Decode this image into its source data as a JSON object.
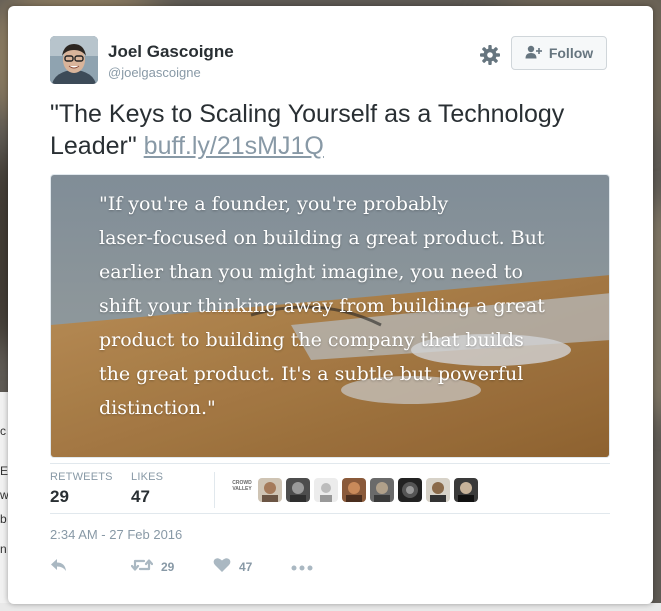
{
  "user": {
    "name": "Joel Gascoigne",
    "handle": "@joelgascoigne"
  },
  "follow_label": "Follow",
  "tweet": {
    "text": "\"The Keys to Scaling Yourself as a Technology Leader\"",
    "link": "buff.ly/21sMJ1Q"
  },
  "media": {
    "quote_lines": [
      "\"If you're a founder, you're probably",
      "laser-focused on building a great product. But",
      "earlier than you might imagine, you need to",
      "shift your thinking away from building a great",
      "product to building the company that builds",
      "the great product. It's a subtle but powerful",
      "distinction.\""
    ]
  },
  "stats": {
    "retweets_label": "RETWEETS",
    "retweets_count": "29",
    "likes_label": "LIKES",
    "likes_count": "47"
  },
  "likers_logo_text": "CROWD VALLEY",
  "timestamp": "2:34 AM - 27 Feb 2016",
  "actions": {
    "retweet_count": "29",
    "like_count": "47"
  },
  "icons": [
    "gear-icon",
    "follow-person-icon",
    "reply-icon",
    "retweet-icon",
    "heart-icon",
    "more-icon"
  ],
  "colors": {
    "text": "#292f33",
    "secondary": "#8899a6",
    "border": "#e1e8ed"
  }
}
